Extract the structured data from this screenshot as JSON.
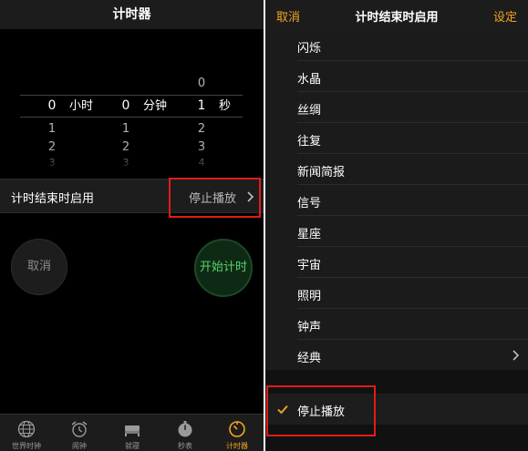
{
  "left": {
    "title": "计时器",
    "picker": {
      "hours": {
        "above": "",
        "selected": "0",
        "below": [
          "1",
          "2",
          "3"
        ],
        "unit": "小时"
      },
      "minutes": {
        "above": "",
        "selected": "0",
        "below": [
          "1",
          "2",
          "3"
        ],
        "unit": "分钟"
      },
      "seconds": {
        "above": "0",
        "selected": "1",
        "below": [
          "2",
          "3",
          "4"
        ],
        "unit": "秒"
      }
    },
    "end_row": {
      "label": "计时结束时启用",
      "value": "停止播放"
    },
    "cancel_label": "取消",
    "start_label": "开始计时",
    "tabs": [
      {
        "label": "世界时钟",
        "icon": "globe-icon"
      },
      {
        "label": "闹钟",
        "icon": "alarm-clock-icon"
      },
      {
        "label": "就寝",
        "icon": "bed-icon"
      },
      {
        "label": "秒表",
        "icon": "stopwatch-icon"
      },
      {
        "label": "计时器",
        "icon": "timer-icon",
        "active": true
      }
    ]
  },
  "right": {
    "cancel_label": "取消",
    "title": "计时结束时启用",
    "set_label": "设定",
    "sounds": [
      "闪烁",
      "水晶",
      "丝绸",
      "往复",
      "新闻简报",
      "信号",
      "星座",
      "宇宙",
      "照明",
      "钟声",
      "经典"
    ],
    "selected": "停止播放"
  },
  "colors": {
    "accent": "#f5a623",
    "start_green": "#5bd26d",
    "highlight_red": "#e01b1b"
  }
}
